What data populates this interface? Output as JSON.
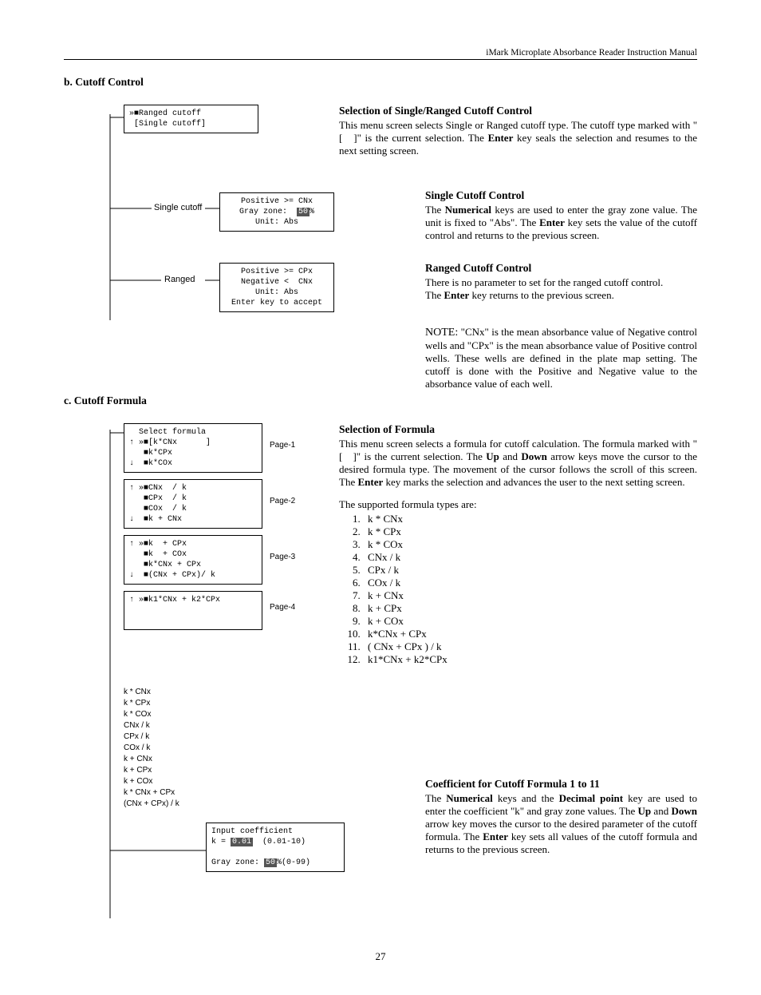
{
  "header": "iMark Microplate Absorbance Reader Instruction Manual",
  "pageNumber": "27",
  "secB": {
    "title": "b.   Cutoff Control",
    "menuBox": "»■Ranged cutoff\n [Single cutoff]",
    "singleLabel": "Single cutoff",
    "singleBox": "Positive >= CNx\nGray zone:  50%\nUnit: Abs",
    "rangedLabel": "Ranged",
    "rangedBox": "Positive >= CPx\nNegative <  CNx\nUnit: Abs\nEnter key to accept",
    "selHead": "Selection of Single/Ranged Cutoff Control",
    "selBody": "This menu screen selects Single or Ranged cutoff type. The cutoff type marked with \"[   ]\" is the current selection. The Enter key seals the selection and resumes to the next setting screen.",
    "scHead": "Single Cutoff Control",
    "scBody": "The Numerical keys are used to enter the gray zone value. The unit is fixed to \"Abs\". The Enter key sets the value of the cutoff control and returns to the previous screen.",
    "rcHead": "Ranged Cutoff Control",
    "rcBody1": "There is no parameter to set for the ranged cutoff control.",
    "rcBody2": "The Enter key returns to the previous screen.",
    "noteBody": "\"CNx\" is the mean absorbance value of Negative control wells and \"CPx\" is the mean absorbance value of Positive control wells. These wells are defined in the plate map setting. The cutoff is done with the Positive and Negative value to the absorbance value of each well."
  },
  "secC": {
    "title": "c.   Cutoff Formula",
    "p1Label": "Page-1",
    "p1Box": "  Select formula\n↑ »■[k*CNx      ]\n   ■k*CPx\n↓  ■k*COx",
    "p2Label": "Page-2",
    "p2Box": "↑ »■CNx  / k\n   ■CPx  / k\n   ■COx  / k\n↓  ■k + CNx",
    "p3Label": "Page-3",
    "p3Box": "↑ »■k  + CPx\n   ■k  + COx\n   ■k*CNx + CPx\n↓  ■(CNx + CPx)/ k",
    "p4Label": "Page-4",
    "p4Box": "↑ »■k1*CNx + k2*CPx\n \n ",
    "shortList": "k * CNx\nk * CPx\nk * COx\nCNx / k\nCPx / k\nCOx / k\nk + CNx\nk + CPx\nk + COx\nk * CNx + CPx\n(CNx + CPx) / k",
    "coeffBox": "Input coefficient\nk = 0.01  (0.01-10)\n\nGray zone: 50%(0-99)",
    "selHead": "Selection of Formula",
    "selBody": "This menu screen selects a formula for cutoff calculation. The formula marked with \"[   ]\" is the current selection. The Up and Down arrow keys move the cursor to the desired formula type. The movement of the cursor follows the scroll of this screen. The Enter key marks the selection and advances the user to the next setting screen.",
    "listIntro": "The supported formula types are:",
    "f1": "k * CNx",
    "f2": "k * CPx",
    "f3": "k * COx",
    "f4": "CNx / k",
    "f5": "CPx / k",
    "f6": "COx / k",
    "f7": "k + CNx",
    "f8": "k + CPx",
    "f9": "k + COx",
    "f10": "k*CNx + CPx",
    "f11": "( CNx + CPx ) / k",
    "f12": "k1*CNx + k2*CPx",
    "coHead": "Coefficient for Cutoff Formula 1 to 11",
    "coBody": "The Numerical keys and the Decimal point key are used to enter the coefficient \"k\" and gray zone values. The Up and Down arrow key moves the cursor to the desired parameter of the cutoff formula. The Enter key sets all values of the cutoff formula and returns to the previous screen."
  }
}
